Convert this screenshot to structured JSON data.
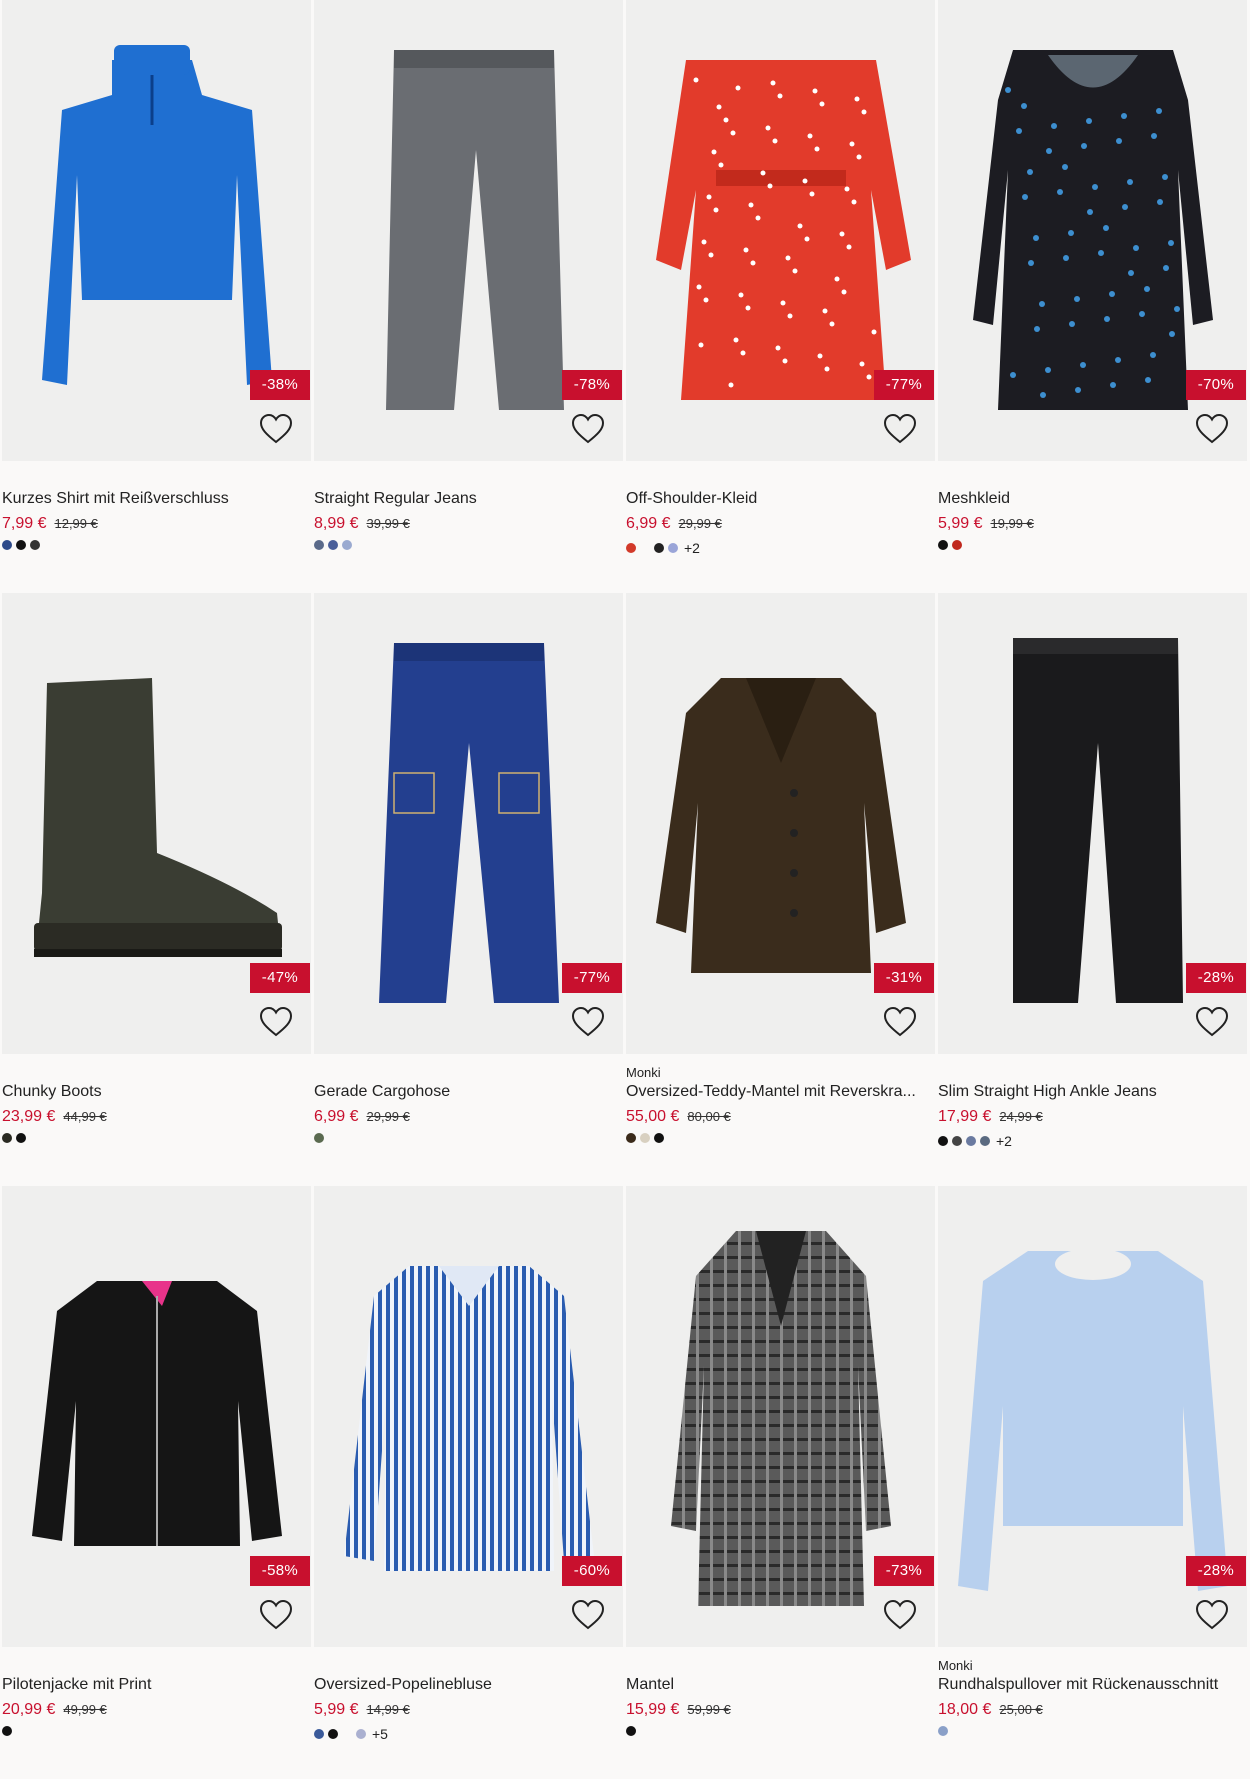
{
  "products": [
    {
      "brand": "",
      "title": "Kurzes Shirt mit Reißverschluss",
      "price": "7,99 €",
      "old_price": "12,99 €",
      "badge": "-38%",
      "swatches": [
        "#2d4a8a",
        "#111111",
        "#333333"
      ],
      "more": "",
      "image": "blue-zip-top",
      "main_color": "#1f6fd1"
    },
    {
      "brand": "",
      "title": "Straight Regular Jeans",
      "price": "8,99 €",
      "old_price": "39,99 €",
      "badge": "-78%",
      "swatches": [
        "#5a6a8a",
        "#4a5f9a",
        "#9aaad0"
      ],
      "more": "",
      "image": "grey-jeans",
      "main_color": "#6a6d72"
    },
    {
      "brand": "",
      "title": "Off-Shoulder-Kleid",
      "price": "6,99 €",
      "old_price": "29,99 €",
      "badge": "-77%",
      "swatches": [
        "#d23a2a",
        "",
        "#222222",
        "#9aa5d8"
      ],
      "more": "+2",
      "image": "red-dress",
      "main_color": "#e23b2b"
    },
    {
      "brand": "",
      "title": "Meshkleid",
      "price": "5,99 €",
      "old_price": "19,99 €",
      "badge": "-70%",
      "swatches": [
        "#111111",
        "#c0281e"
      ],
      "more": "",
      "image": "black-floral-dress",
      "main_color": "#1c1c22"
    },
    {
      "brand": "",
      "title": "Chunky Boots",
      "price": "23,99 €",
      "old_price": "44,99 €",
      "badge": "-47%",
      "swatches": [
        "#2a2a22",
        "#111111"
      ],
      "more": "",
      "image": "boot",
      "main_color": "#3a3d33"
    },
    {
      "brand": "",
      "title": "Gerade Cargohose",
      "price": "6,99 €",
      "old_price": "29,99 €",
      "badge": "-77%",
      "swatches": [
        "#5a6a50"
      ],
      "more": "",
      "image": "blue-cargo-jeans",
      "main_color": "#233f8f"
    },
    {
      "brand": "Monki",
      "title": "Oversized-Teddy-Mantel mit Reverskra...",
      "price": "55,00 €",
      "old_price": "80,00 €",
      "badge": "-31%",
      "swatches": [
        "#3a2a1a",
        "#d8d0c0",
        "#111111"
      ],
      "more": "",
      "image": "teddy-coat",
      "main_color": "#3a2c1c"
    },
    {
      "brand": "",
      "title": "Slim Straight High Ankle Jeans",
      "price": "17,99 €",
      "old_price": "24,99 €",
      "badge": "-28%",
      "swatches": [
        "#111111",
        "#444444",
        "#6a7aa0",
        "#5a6a80"
      ],
      "more": "+2",
      "image": "black-jeans",
      "main_color": "#1a1a1c"
    },
    {
      "brand": "",
      "title": "Pilotenjacke mit Print",
      "price": "20,99 €",
      "old_price": "49,99 €",
      "badge": "-58%",
      "swatches": [
        "#111111"
      ],
      "more": "",
      "image": "bomber-jacket",
      "main_color": "#151515"
    },
    {
      "brand": "",
      "title": "Oversized-Popelinebluse",
      "price": "5,99 €",
      "old_price": "14,99 €",
      "badge": "-60%",
      "swatches": [
        "#3a5a9a",
        "#111111",
        "",
        "#aab0d0"
      ],
      "more": "+5",
      "image": "striped-shirt",
      "main_color": "#4a86d0"
    },
    {
      "brand": "",
      "title": "Mantel",
      "price": "15,99 €",
      "old_price": "59,99 €",
      "badge": "-73%",
      "swatches": [
        "#111111"
      ],
      "more": "",
      "image": "plaid-coat",
      "main_color": "#5a5a5a"
    },
    {
      "brand": "Monki",
      "title": "Rundhalspullover mit Rückenausschnitt",
      "price": "18,00 €",
      "old_price": "25,00 €",
      "badge": "-28%",
      "swatches": [
        "#8aa0c8"
      ],
      "more": "",
      "image": "light-blue-sweater",
      "main_color": "#b8d0ee"
    }
  ]
}
